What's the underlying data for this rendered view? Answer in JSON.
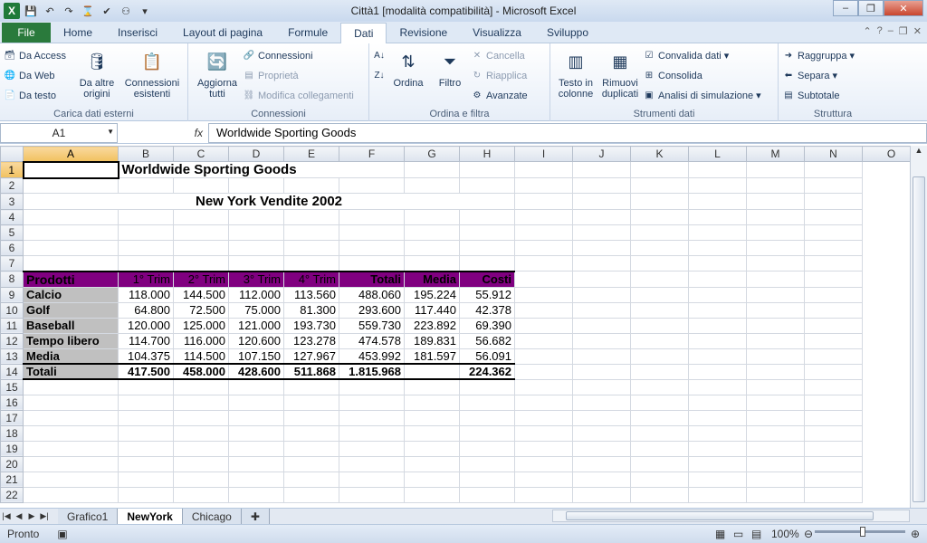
{
  "window": {
    "title": "Città1  [modalità compatibilità]  -  Microsoft Excel",
    "app_icon_letter": "X"
  },
  "tabs": [
    {
      "label": "File"
    },
    {
      "label": "Home"
    },
    {
      "label": "Inserisci"
    },
    {
      "label": "Layout di pagina"
    },
    {
      "label": "Formule"
    },
    {
      "label": "Dati",
      "active": true
    },
    {
      "label": "Revisione"
    },
    {
      "label": "Visualizza"
    },
    {
      "label": "Sviluppo"
    }
  ],
  "ribbon": {
    "groups": {
      "external": {
        "name": "Carica dati esterni",
        "access": "Da Access",
        "web": "Da Web",
        "text": "Da testo",
        "other": "Da altre origini",
        "existing": "Connessioni esistenti"
      },
      "connections": {
        "name": "Connessioni",
        "refresh": "Aggiorna tutti",
        "connections": "Connessioni",
        "properties": "Proprietà",
        "edit_links": "Modifica collegamenti"
      },
      "sort": {
        "name": "Ordina e filtra",
        "sort": "Ordina",
        "filter": "Filtro",
        "clear": "Cancella",
        "reapply": "Riapplica",
        "advanced": "Avanzate"
      },
      "tools": {
        "name": "Strumenti dati",
        "text_to_columns": "Testo in colonne",
        "remove_dup": "Rimuovi duplicati",
        "validation": "Convalida dati",
        "consolidate": "Consolida",
        "whatif": "Analisi di simulazione"
      },
      "outline": {
        "name": "Struttura",
        "group": "Raggruppa",
        "ungroup": "Separa",
        "subtotal": "Subtotale"
      }
    }
  },
  "formula_bar": {
    "name_box": "A1",
    "fx": "fx",
    "content": "Worldwide Sporting Goods"
  },
  "grid": {
    "columns": [
      "A",
      "B",
      "C",
      "D",
      "E",
      "F",
      "G",
      "H",
      "I",
      "J",
      "K",
      "L",
      "M",
      "N",
      "O"
    ],
    "title": "Worldwide Sporting Goods",
    "subtitle": "New York Vendite 2002",
    "header": [
      "Prodotti",
      "1° Trim",
      "2° Trim",
      "3° Trim",
      "4° Trim",
      "Totali",
      "Media",
      "Costi"
    ],
    "rows": [
      [
        "Calcio",
        "118.000",
        "144.500",
        "112.000",
        "113.560",
        "488.060",
        "195.224",
        "55.912"
      ],
      [
        "Golf",
        "64.800",
        "72.500",
        "75.000",
        "81.300",
        "293.600",
        "117.440",
        "42.378"
      ],
      [
        "Baseball",
        "120.000",
        "125.000",
        "121.000",
        "193.730",
        "559.730",
        "223.892",
        "69.390"
      ],
      [
        "Tempo libero",
        "114.700",
        "116.000",
        "120.600",
        "123.278",
        "474.578",
        "189.831",
        "56.682"
      ],
      [
        "Media",
        "104.375",
        "114.500",
        "107.150",
        "127.967",
        "453.992",
        "181.597",
        "56.091"
      ],
      [
        "Totali",
        "417.500",
        "458.000",
        "428.600",
        "511.868",
        "1.815.968",
        "",
        "224.362"
      ]
    ]
  },
  "sheets": [
    "Grafico1",
    "NewYork",
    "Chicago"
  ],
  "status": {
    "mode": "Pronto",
    "zoom": "100%",
    "zoom_level_percent": 100
  }
}
